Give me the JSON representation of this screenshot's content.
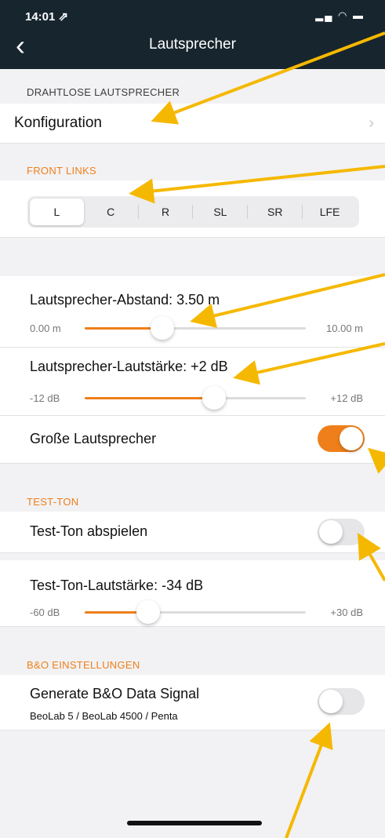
{
  "status_bar": {
    "time": "14:01 ⇗",
    "icons": "▂▄ ◠ ▬"
  },
  "nav": {
    "back_icon": "‹",
    "title": "Lautsprecher"
  },
  "wireless": {
    "header": "DRAHTLOSE LAUTSPRECHER",
    "config_label": "Konfiguration",
    "chevron": "›"
  },
  "front": {
    "header": "FRONT LINKS",
    "segments": [
      "L",
      "C",
      "R",
      "SL",
      "SR",
      "LFE"
    ],
    "selected": "L"
  },
  "distance": {
    "label": "Lautsprecher-Abstand:  3.50 m",
    "min": "0.00 m",
    "max": "10.00 m",
    "value": 3.5,
    "range": [
      0,
      10
    ]
  },
  "volume": {
    "label": "Lautsprecher-Lautstärke:  +2 dB",
    "min": "-12 dB",
    "max": "+12 dB",
    "value": 2,
    "range": [
      -12,
      12
    ]
  },
  "large": {
    "label": "Große Lautsprecher",
    "on": true
  },
  "test": {
    "header": "TEST-TON",
    "play_label": "Test-Ton abspielen",
    "play_on": false,
    "vol_label": "Test-Ton-Lautstärke:  -34 dB",
    "min": "-60 dB",
    "max": "+30 dB",
    "value": -34,
    "range": [
      -60,
      30
    ]
  },
  "bo": {
    "header": "B&O EINSTELLUNGEN",
    "signal_label": "Generate B&O Data Signal",
    "signal_sub": "BeoLab 5 / BeoLab 4500 / Penta",
    "on": false
  },
  "colors": {
    "accent": "#ef7f1a",
    "nav_bg": "#17252e",
    "arrow": "#f5b800"
  }
}
